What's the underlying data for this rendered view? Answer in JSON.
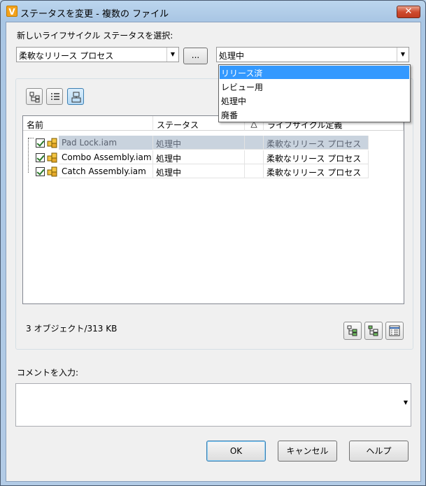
{
  "window": {
    "title": "ステータスを変更 - 複数の ファイル",
    "app_icon_letter": "V",
    "close_glyph": "✕"
  },
  "select_label": "新しいライフサイクル ステータスを選択:",
  "process_combo": {
    "value": "柔軟なリリース プロセス"
  },
  "ellipsis_label": "...",
  "status_combo": {
    "value": "処理中",
    "options": [
      "リリース済",
      "レビュー用",
      "処理中",
      "廃番"
    ],
    "highlighted": "リリース済"
  },
  "grid": {
    "columns": [
      "名前",
      "ステータス",
      "△",
      "ライフサイクル定義"
    ],
    "rows": [
      {
        "name": "Pad Lock.iam",
        "status": "処理中",
        "lifecycle": "柔軟なリリース プロセス",
        "checked": true
      },
      {
        "name": "Combo Assembly.iam",
        "status": "処理中",
        "lifecycle": "柔軟なリリース プロセス",
        "checked": true
      },
      {
        "name": "Catch Assembly.iam",
        "status": "処理中",
        "lifecycle": "柔軟なリリース プロセス",
        "checked": true
      }
    ]
  },
  "summary": "3 オブジェクト/313 KB",
  "comment_label": "コメントを入力:",
  "comment_value": "",
  "buttons": {
    "ok": "OK",
    "cancel": "キャンセル",
    "help": "ヘルプ"
  },
  "colors": {
    "highlight": "#3399ff",
    "selected_row": "#c9d3de"
  }
}
